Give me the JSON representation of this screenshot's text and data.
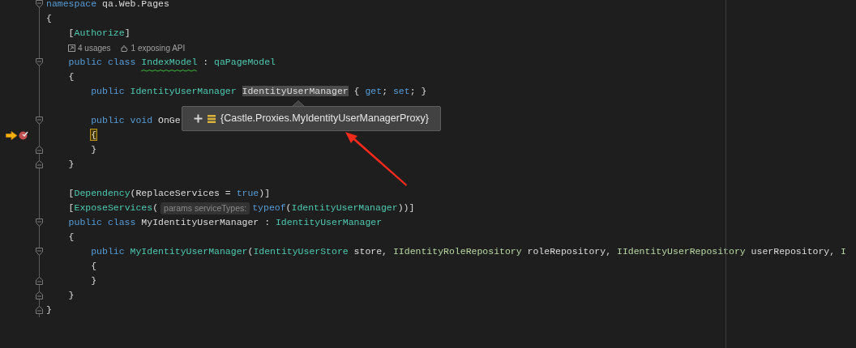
{
  "editor": {
    "lines": [
      {
        "kind": "code",
        "fold_start": true,
        "fold_end": false,
        "breakpoint": false,
        "current": false,
        "tokens": [
          {
            "kind": "kw",
            "text": "namespace"
          },
          {
            "kind": "plain",
            "text": " qa.Web.Pages"
          }
        ]
      },
      {
        "kind": "code",
        "fold_start": false,
        "fold_end": false,
        "breakpoint": false,
        "current": false,
        "tokens": [
          {
            "kind": "plain",
            "text": "{"
          }
        ]
      },
      {
        "kind": "code",
        "fold_start": false,
        "fold_end": false,
        "breakpoint": false,
        "current": false,
        "tokens": [
          {
            "kind": "plain",
            "text": "    ["
          },
          {
            "kind": "type",
            "text": "Authorize"
          },
          {
            "kind": "plain",
            "text": "]"
          }
        ]
      },
      {
        "kind": "codelens",
        "items": [
          {
            "text": "4 usages"
          },
          {
            "text": "1 exposing API"
          }
        ]
      },
      {
        "kind": "code",
        "fold_start": true,
        "fold_end": false,
        "breakpoint": false,
        "current": false,
        "tokens": [
          {
            "kind": "kw",
            "text": "    public class "
          },
          {
            "kind": "type",
            "text": "IndexModel",
            "squiggle": true
          },
          {
            "kind": "plain",
            "text": " : "
          },
          {
            "kind": "type",
            "text": "qaPageModel"
          }
        ]
      },
      {
        "kind": "code",
        "fold_start": false,
        "fold_end": false,
        "breakpoint": false,
        "current": false,
        "tokens": [
          {
            "kind": "plain",
            "text": "    {"
          }
        ]
      },
      {
        "kind": "code",
        "fold_start": false,
        "fold_end": false,
        "breakpoint": false,
        "current": false,
        "tokens": [
          {
            "kind": "kw",
            "text": "        public "
          },
          {
            "kind": "type",
            "text": "IdentityUserManager "
          },
          {
            "kind": "plain",
            "text": "IdentityUserManager",
            "highlight": true
          },
          {
            "kind": "plain",
            "text": " { "
          },
          {
            "kind": "kw",
            "text": "get"
          },
          {
            "kind": "plain",
            "text": "; "
          },
          {
            "kind": "kw",
            "text": "set"
          },
          {
            "kind": "plain",
            "text": "; }"
          }
        ]
      },
      {
        "kind": "blank"
      },
      {
        "kind": "code",
        "fold_start": true,
        "fold_end": false,
        "breakpoint": false,
        "current": false,
        "tokens": [
          {
            "kind": "kw",
            "text": "        public void "
          },
          {
            "kind": "plain",
            "text": "OnGe"
          }
        ]
      },
      {
        "kind": "code",
        "fold_start": false,
        "fold_end": false,
        "breakpoint": true,
        "current": true,
        "tokens": [
          {
            "kind": "plain",
            "text": "        {",
            "match": true
          }
        ]
      },
      {
        "kind": "code",
        "fold_start": false,
        "fold_end": true,
        "breakpoint": false,
        "current": false,
        "tokens": [
          {
            "kind": "plain",
            "text": "        }"
          }
        ]
      },
      {
        "kind": "code",
        "fold_start": false,
        "fold_end": true,
        "breakpoint": false,
        "current": false,
        "tokens": [
          {
            "kind": "plain",
            "text": "    }"
          }
        ]
      },
      {
        "kind": "blank"
      },
      {
        "kind": "code",
        "fold_start": false,
        "fold_end": false,
        "breakpoint": false,
        "current": false,
        "tokens": [
          {
            "kind": "plain",
            "text": "    ["
          },
          {
            "kind": "type",
            "text": "Dependency"
          },
          {
            "kind": "plain",
            "text": "(ReplaceServices = "
          },
          {
            "kind": "kw",
            "text": "true"
          },
          {
            "kind": "plain",
            "text": ")]"
          }
        ]
      },
      {
        "kind": "code",
        "fold_start": false,
        "fold_end": false,
        "breakpoint": false,
        "current": false,
        "tokens": [
          {
            "kind": "plain",
            "text": "    ["
          },
          {
            "kind": "type",
            "text": "ExposeServices"
          },
          {
            "kind": "plain",
            "text": "("
          },
          {
            "kind": "hint",
            "text": "params serviceTypes:"
          },
          {
            "kind": "kw",
            "text": "typeof"
          },
          {
            "kind": "plain",
            "text": "("
          },
          {
            "kind": "type",
            "text": "IdentityUserManager"
          },
          {
            "kind": "plain",
            "text": "))]"
          }
        ]
      },
      {
        "kind": "code",
        "fold_start": true,
        "fold_end": false,
        "breakpoint": false,
        "current": false,
        "tokens": [
          {
            "kind": "kw",
            "text": "    public class "
          },
          {
            "kind": "plain",
            "text": "MyIdentityUserManager : "
          },
          {
            "kind": "type",
            "text": "IdentityUserManager"
          }
        ]
      },
      {
        "kind": "code",
        "fold_start": false,
        "fold_end": false,
        "breakpoint": false,
        "current": false,
        "tokens": [
          {
            "kind": "plain",
            "text": "    {"
          }
        ]
      },
      {
        "kind": "code",
        "fold_start": true,
        "fold_end": false,
        "breakpoint": false,
        "current": false,
        "tokens": [
          {
            "kind": "kw",
            "text": "        public "
          },
          {
            "kind": "type",
            "text": "MyIdentityUserManager"
          },
          {
            "kind": "plain",
            "text": "("
          },
          {
            "kind": "type",
            "text": "IdentityUserStore"
          },
          {
            "kind": "plain",
            "text": " store, "
          },
          {
            "kind": "iface",
            "text": "IIdentityRoleRepository"
          },
          {
            "kind": "plain",
            "text": " roleRepository, "
          },
          {
            "kind": "iface",
            "text": "IIdentityUserRepository"
          },
          {
            "kind": "plain",
            "text": " userRepository, "
          },
          {
            "kind": "iface",
            "text": "I"
          }
        ]
      },
      {
        "kind": "code",
        "fold_start": false,
        "fold_end": false,
        "breakpoint": false,
        "current": false,
        "tokens": [
          {
            "kind": "plain",
            "text": "        {"
          }
        ]
      },
      {
        "kind": "code",
        "fold_start": false,
        "fold_end": true,
        "breakpoint": false,
        "current": false,
        "tokens": [
          {
            "kind": "plain",
            "text": "        }"
          }
        ]
      },
      {
        "kind": "code",
        "fold_start": false,
        "fold_end": true,
        "breakpoint": false,
        "current": false,
        "tokens": [
          {
            "kind": "plain",
            "text": "    }"
          }
        ]
      },
      {
        "kind": "code",
        "fold_start": false,
        "fold_end": true,
        "breakpoint": false,
        "current": false,
        "tokens": [
          {
            "kind": "plain",
            "text": "}"
          }
        ]
      }
    ]
  },
  "datatip": {
    "text": "{Castle.Proxies.MyIdentityUserManagerProxy}"
  }
}
